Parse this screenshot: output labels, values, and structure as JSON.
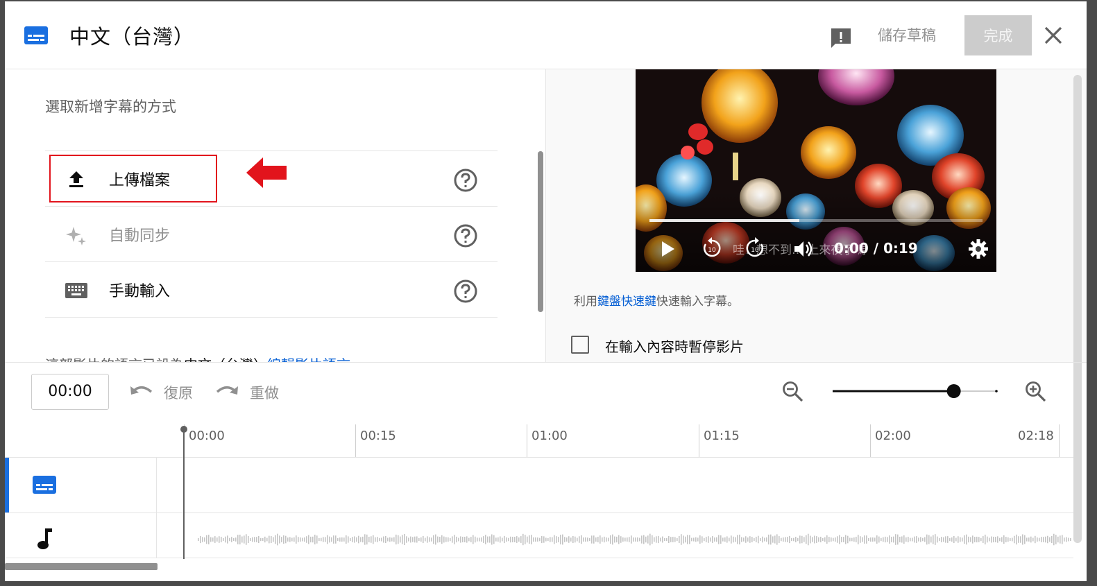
{
  "header": {
    "title": "中文（台灣）",
    "save_draft": "儲存草稿",
    "done": "完成",
    "icons": {
      "caption": "closed-caption-icon",
      "feedback": "feedback-icon",
      "close": "close-icon"
    }
  },
  "left": {
    "title": "選取新增字幕的方式",
    "options": [
      {
        "label": "上傳檔案",
        "icon": "upload-icon",
        "disabled": false
      },
      {
        "label": "自動同步",
        "icon": "sparkle-icon",
        "disabled": true
      },
      {
        "label": "手動輸入",
        "icon": "keyboard-icon",
        "disabled": false
      }
    ],
    "lang_note_prefix": "這部影片的語言已設為",
    "lang_note_lang": "中文（台灣）",
    "lang_note_link": "編輯影片語言"
  },
  "video": {
    "caption": "哇！想不到… 上來夜了嗎",
    "time": "0:00 / 0:19",
    "progress": 0.45
  },
  "right": {
    "kb_prefix": "利用",
    "kb_link": "鍵盤快速鍵",
    "kb_suffix": "快速輸入字幕。",
    "pause_label": "在輸入內容時暫停影片",
    "pause_checked": false
  },
  "toolbar": {
    "time": "00:00",
    "undo": "復原",
    "redo": "重做",
    "zoom_level": 0.74
  },
  "timeline": {
    "ticks": [
      "00:00",
      "00:15",
      "01:00",
      "01:15",
      "02:00",
      "02:18"
    ]
  },
  "colors": {
    "accent": "#065fd4",
    "highlight": "#e2141c",
    "subtitle_track": "#1a6fe0"
  }
}
